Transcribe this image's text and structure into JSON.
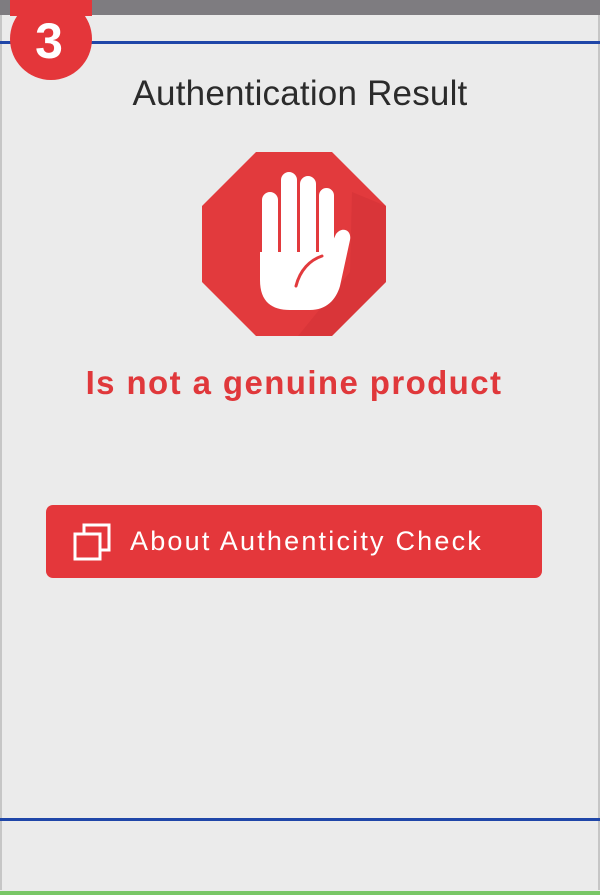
{
  "step": {
    "number": "3"
  },
  "header": {
    "title": "Authentication Result"
  },
  "result": {
    "icon": "stop-hand-icon",
    "message": "Is not a genuine product"
  },
  "actions": {
    "about_icon": "copy-windows-icon",
    "about_label": "About Authenticity Check"
  },
  "colors": {
    "background": "#ebebeb",
    "accent_red": "#e4363a",
    "rule_blue": "#1f46a8",
    "status_gray": "#7e7c80",
    "title_text": "#2b2b2b",
    "bottom_green": "#78c766"
  }
}
